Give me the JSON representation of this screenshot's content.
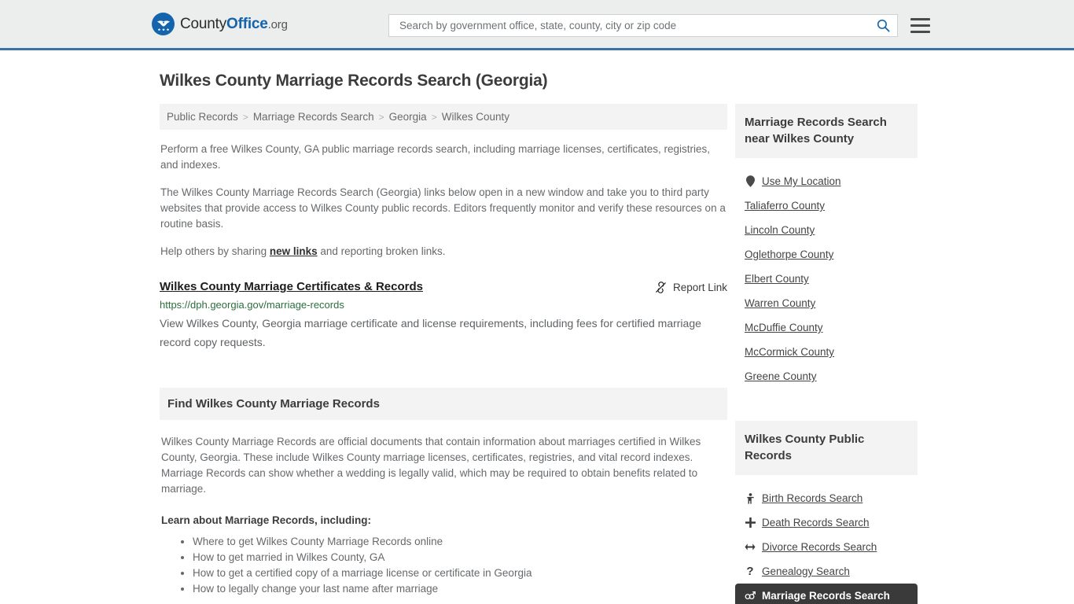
{
  "header": {
    "logo_text_1": "County",
    "logo_text_2": "Office",
    "logo_text_3": ".org",
    "search_placeholder": "Search by government office, state, county, city or zip code",
    "search_value": "",
    "search_icon": "search-icon",
    "menu_icon": "hamburger-menu-icon"
  },
  "page": {
    "title": "Wilkes County Marriage Records Search (Georgia)"
  },
  "breadcrumb": {
    "items": [
      {
        "label": "Public Records"
      },
      {
        "label": "Marriage Records Search"
      },
      {
        "label": "Georgia"
      },
      {
        "label": "Wilkes County"
      }
    ],
    "separator": ">"
  },
  "intro": {
    "p1": "Perform a free Wilkes County, GA public marriage records search, including marriage licenses, certificates, registries, and indexes.",
    "p2": "The Wilkes County Marriage Records Search (Georgia) links below open in a new window and take you to third party websites that provide access to Wilkes County public records. Editors frequently monitor and verify these resources on a routine basis.",
    "p3_before": "Help others by sharing ",
    "p3_link": "new links",
    "p3_after": " and reporting broken links."
  },
  "result": {
    "title": "Wilkes County Marriage Certificates & Records",
    "url": "https://dph.georgia.gov/marriage-records",
    "description": "View Wilkes County, Georgia marriage certificate and license requirements, including fees for certified marriage record copy requests.",
    "report_label": "Report Link",
    "report_icon": "broken-link-icon"
  },
  "section": {
    "heading": "Find Wilkes County Marriage Records",
    "body": "Wilkes County Marriage Records are official documents that contain information about marriages certified in Wilkes County, Georgia. These include Wilkes County marriage licenses, certificates, registries, and vital record indexes. Marriage Records can show whether a wedding is legally valid, which may be required to obtain benefits related to marriage.",
    "learn_heading": "Learn about Marriage Records, including:",
    "learn_items": [
      "Where to get Wilkes County Marriage Records online",
      "How to get married in Wilkes County, GA",
      "How to get a certified copy of a marriage license or certificate in Georgia",
      "How to legally change your last name after marriage"
    ]
  },
  "sidebar": {
    "panel1": {
      "heading": "Marriage Records Search near Wilkes County",
      "items": [
        {
          "label": "Use My Location",
          "icon": "map-pin-icon"
        },
        {
          "label": "Taliaferro County",
          "icon": ""
        },
        {
          "label": "Lincoln County",
          "icon": ""
        },
        {
          "label": "Oglethorpe County",
          "icon": ""
        },
        {
          "label": "Elbert County",
          "icon": ""
        },
        {
          "label": "Warren County",
          "icon": ""
        },
        {
          "label": "McDuffie County",
          "icon": ""
        },
        {
          "label": "McCormick County",
          "icon": ""
        },
        {
          "label": "Greene County",
          "icon": ""
        }
      ]
    },
    "panel2": {
      "heading": "Wilkes County Public Records",
      "items": [
        {
          "label": "Birth Records Search",
          "icon": "baby-icon",
          "glyph": "Ж",
          "active": false
        },
        {
          "label": "Death Records Search",
          "icon": "cross-icon",
          "glyph": "✚",
          "active": false
        },
        {
          "label": "Divorce Records Search",
          "icon": "left-right-arrow-icon",
          "glyph": "↔",
          "active": false
        },
        {
          "label": "Genealogy Search",
          "icon": "question-mark-icon",
          "glyph": "?",
          "active": false
        },
        {
          "label": "Marriage Records Search",
          "icon": "marriage-symbol-icon",
          "glyph": "⚥",
          "active": true
        }
      ]
    }
  },
  "colors": {
    "brand_blue": "#1363ad",
    "header_border": "#3b72a4",
    "header_bg": "#eceded",
    "panel_bg": "#f3f3f3",
    "url_green": "#2c6e3d",
    "active_bg": "#3a3a3a"
  }
}
